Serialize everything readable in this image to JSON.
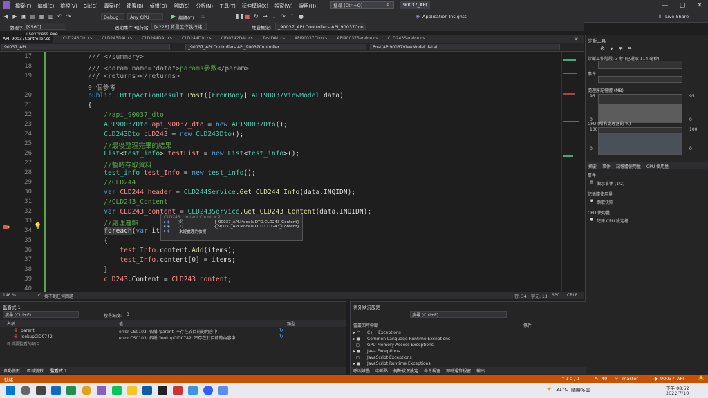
{
  "menu": {
    "items": [
      "檔案(F)",
      "編輯(E)",
      "檢視(V)",
      "Git(G)",
      "專案(P)",
      "建置(B)",
      "偵錯(D)",
      "測試(S)",
      "分析(N)",
      "工具(T)",
      "延伸模組(X)",
      "視窗(W)",
      "說明(H)"
    ],
    "search_placeholder": "搜尋 (Ctrl+Q)",
    "project_name": "90037_API"
  },
  "toolbar": {
    "config": "Debug",
    "platform": "Any CPU",
    "continue_label": "繼續(C)",
    "app_insights": "Application Insights",
    "live_share": "Live Share",
    "process_label": "處理序:",
    "process_value": "[9560] iisexpress.exe",
    "lifecycle_label": "週期事件 ▾",
    "thread_label": "執行緒:",
    "thread_value": "[4228] 背景工作執行緒",
    "stack_label": "堆疊框架:",
    "stack_value": "_90037_API.Controllers.API_90037Contr"
  },
  "tabs": [
    {
      "label": "API_90037Controller.cs",
      "active": true
    },
    {
      "label": "CLD243Dto.cs",
      "active": false
    },
    {
      "label": "CLD243DAL.cs",
      "active": false
    },
    {
      "label": "CLD244DAL.cs",
      "active": false
    },
    {
      "label": "CLD244Dto.cs",
      "active": false
    },
    {
      "label": "CID0742DAL.cs",
      "active": false
    },
    {
      "label": "TestDAL.cs",
      "active": false
    },
    {
      "label": "API90037Dto.cs",
      "active": false
    },
    {
      "label": "API90037Service.cs",
      "active": false
    },
    {
      "label": "CLD243Service.cs",
      "active": false
    }
  ],
  "navbar": {
    "project": "90037_API",
    "class": "_90037_API.Controllers.API_90037Controller",
    "member": "Post(API90037ViewModel data)"
  },
  "editor": {
    "lines": [
      {
        "n": "17",
        "html": "    <span class='gr'>/// &lt;/summary&gt;</span>"
      },
      {
        "n": "18",
        "html": "    <span class='gr'>/// &lt;param name=</span><span class='gr'>\"data\"</span><span class='gr'>&gt;</span><span class='cm'>params參數</span><span class='gr'>&lt;/param&gt;</span>"
      },
      {
        "n": "19",
        "html": "    <span class='gr'>/// &lt;returns&gt;&lt;/returns&gt;</span>"
      },
      {
        "n": "",
        "html": "    <span class='gr'>0 個參考</span>"
      },
      {
        "n": "20",
        "html": "    <span class='kw'>public</span> <span class='ty'>IHttpActionResult</span> <span class='me'>Post</span>([<span class='ty'>FromBody</span>] <span class='ty'>API90037ViewModel</span> data)"
      },
      {
        "n": "21",
        "html": "    {"
      },
      {
        "n": "22",
        "html": "        <span class='cm'>//api_90037_dto</span>"
      },
      {
        "n": "23",
        "html": "        <span class='ty'>API90037Dto</span> <span class='va'>api_90037_dto</span> = <span class='kw'>new</span> <span class='ty'>API90037Dto</span>();"
      },
      {
        "n": "24",
        "html": "        <span class='ty'>CLD243Dto</span> <span class='va'>cLD243</span> = <span class='kw'>new</span> <span class='ty'>CLD243Dto</span>();"
      },
      {
        "n": "25",
        "html": "        <span class='cm'>//最後整理完畢的結果</span>"
      },
      {
        "n": "26",
        "html": "        <span class='ty'>List</span>&lt;<span class='ty'>test_info</span>&gt; <span class='va'>testList</span> = <span class='kw'>new</span> <span class='ty'>List</span>&lt;<span class='ty'>test_info</span>&gt;();"
      },
      {
        "n": "27",
        "html": "        <span class='cm'>//暫時存取資料</span>"
      },
      {
        "n": "28",
        "html": "        <span class='ty'>test_info</span> <span class='va'>test_Info</span> = <span class='kw'>new</span> <span class='ty'>test_info</span>();"
      },
      {
        "n": "29",
        "html": "        <span class='cm'>//CLD244</span>"
      },
      {
        "n": "30",
        "html": "        <span class='kw'>var</span> <span class='va'>CLD244_header</span> = <span class='ty'>CLD244Service</span>.<span class='me'>Get_CLD244_Info</span>(data.INQIDN);"
      },
      {
        "n": "31",
        "html": "        <span class='cm'>//CLD243_Content</span>"
      },
      {
        "n": "32",
        "html": "        <span class='kw'>var</span> <span class='va'>CLD243_content</span> = <span class='ty'>CLD243Service</span>.<span class='me'>Get_CLD243_Content</span>(data.INQIDN);"
      },
      {
        "n": "33",
        "html": "        <span class='cm'>//處理邏輯</span>"
      },
      {
        "n": "34",
        "html": "        <span style='background:#3a3a3a'>foreach</span>(<span class='kw'>var</span> it"
      },
      {
        "n": "35",
        "html": "        {"
      },
      {
        "n": "36",
        "html": "            <span class='va'>test_Info</span>.content.<span class='me'>Add</span>(items);"
      },
      {
        "n": "37",
        "html": "            <span class='va'>test_Info</span>.content[0] = items;"
      },
      {
        "n": "38",
        "html": "        }"
      },
      {
        "n": "39",
        "html": "        <span class='va'>cLD243</span>.Content = <span class='va'>CLD243_content</span>;"
      },
      {
        "n": "40",
        "html": ""
      }
    ]
  },
  "datatip": {
    "header": "CLD243_content   Count = 2",
    "rows": [
      {
        "label": "[0]",
        "value": "{_90037_API.Models.DTO.CLD243_Content}"
      },
      {
        "label": "[1]",
        "value": "{_90037_API.Models.DTO.CLD243_Content}"
      },
      {
        "label": "未經處理的檢視",
        "value": ""
      }
    ]
  },
  "editor_status": {
    "zoom": "146 %",
    "issues": "找不到任何問題",
    "line": "行: 34",
    "col": "字元: 13",
    "spc": "SPC",
    "crlf": "CRLF"
  },
  "diagnostics": {
    "title": "診斷工具",
    "session": "診斷工作階段: 3 秒 (已選取 114 毫秒)",
    "events_label": "事件",
    "memory_label": "處理序記憶體 (MB)",
    "mem_top": "95",
    "mem_bottom": "0",
    "mem_top_r": "95",
    "mem_bottom_r": "0",
    "cpu_label": "CPU (所有處理器的 %)",
    "cpu_top": "100",
    "cpu_bottom": "0",
    "cpu_top_r": "100",
    "cpu_bottom_r": "0",
    "subtabs": [
      "摘要",
      "事件",
      "記憶體使用量",
      "CPU 使用量"
    ],
    "sec_events": "事件",
    "show_events": "顯示事件 (1/2)",
    "sec_memory": "記憶體使用量",
    "snapshot": "擷取快照",
    "sec_cpu": "CPU 使用量",
    "record_cpu": "記錄 CPU 設定檔"
  },
  "watch": {
    "title": "監看式 1",
    "search_placeholder": "搜尋 (Ctrl+E)",
    "depth_label": "搜尋深度:",
    "depth_value": "3",
    "col_name": "名稱",
    "col_value": "值",
    "col_type": "類型",
    "rows": [
      {
        "name": "parent",
        "value": "error CS0103: 名稱 'parent' 不存在於目前的內容中"
      },
      {
        "name": "lookupCID0742",
        "value": "error CS0103: 名稱 'lookupCID0742' 不存在於目前的內容中"
      }
    ],
    "add_item": "新增要監看的項目",
    "bottom_tabs": [
      "自動變數",
      "區域變數",
      "監看式 1"
    ]
  },
  "exceptions": {
    "title": "例外狀況設定",
    "search_placeholder": "搜尋 (Ctrl+E)",
    "col_name": "當叢回時中斷",
    "col_cond": "條件",
    "rows": [
      "C++ Exceptions",
      "Common Language Runtime Exceptions",
      "GPU Memory Access Exceptions",
      "Java Exceptions",
      "JavaScript Exceptions",
      "JavaScript Runtime Exceptions"
    ],
    "bottom_tabs": [
      "呼叫堆疊",
      "中斷點",
      "例外狀況設定",
      "命令視窗",
      "即時運算視窗",
      "輸出"
    ]
  },
  "statusbar": {
    "ready": "就緒",
    "updown": "0 / 1",
    "edits": "40",
    "branch": "master",
    "repo": "90037_API"
  },
  "taskbar": {
    "temp": "31°C",
    "weather": "晴時多雲",
    "time": "下午 08:52",
    "date": "2022/7/10"
  },
  "colors": {
    "statusbar": "#ca5100",
    "editor_bg": "#1e1e1e",
    "keyword": "#569cd6",
    "type": "#4ec9b0",
    "comment": "#57a64a"
  }
}
